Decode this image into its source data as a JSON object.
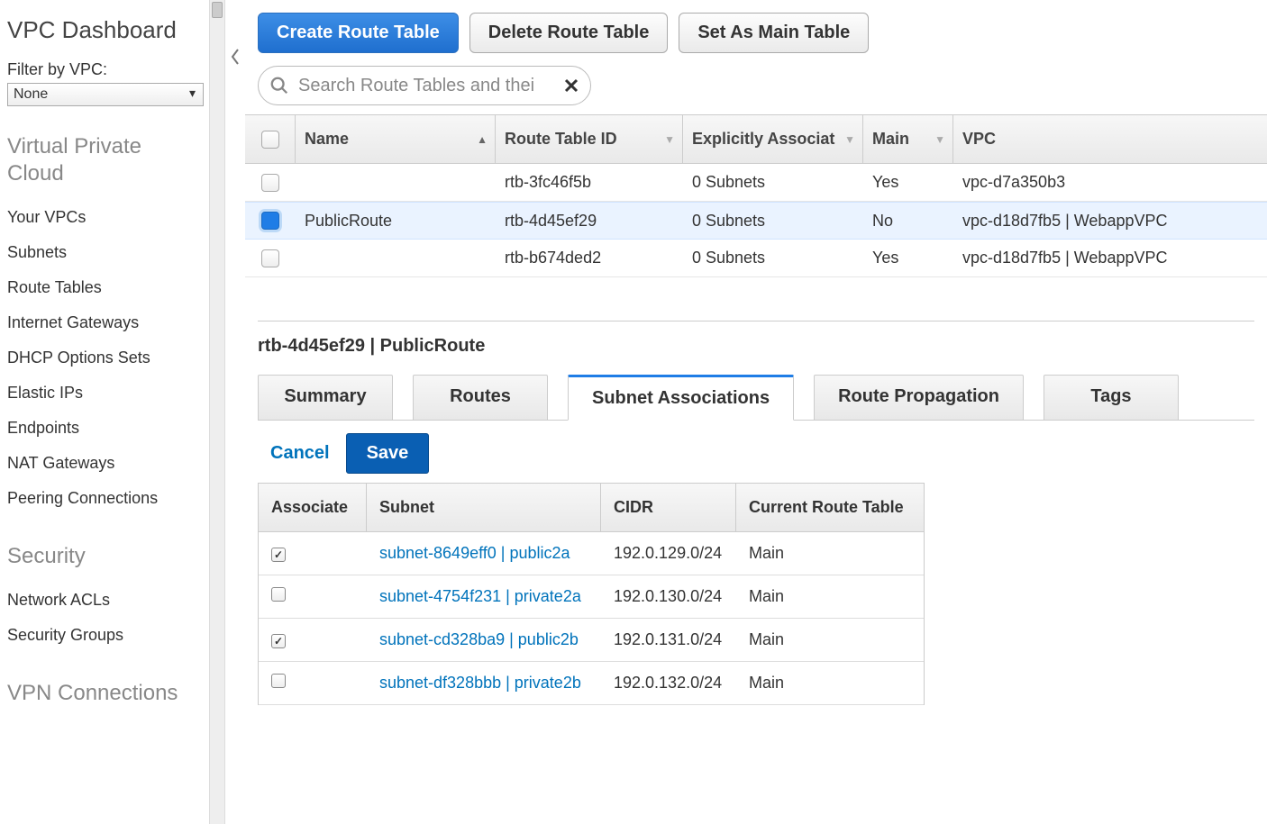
{
  "sidebar": {
    "title": "VPC Dashboard",
    "filter_label": "Filter by VPC:",
    "filter_value": "None",
    "sections": [
      {
        "heading": "Virtual Private Cloud",
        "items": [
          "Your VPCs",
          "Subnets",
          "Route Tables",
          "Internet Gateways",
          "DHCP Options Sets",
          "Elastic IPs",
          "Endpoints",
          "NAT Gateways",
          "Peering Connections"
        ]
      },
      {
        "heading": "Security",
        "items": [
          "Network ACLs",
          "Security Groups"
        ]
      },
      {
        "heading": "VPN Connections",
        "items": []
      }
    ]
  },
  "toolbar": {
    "create": "Create Route Table",
    "delete": "Delete Route Table",
    "setmain": "Set As Main Table"
  },
  "search": {
    "placeholder": "Search Route Tables and thei"
  },
  "table": {
    "headers": {
      "name": "Name",
      "rtid": "Route Table ID",
      "assoc": "Explicitly Associat",
      "main": "Main",
      "vpc": "VPC"
    },
    "rows": [
      {
        "selected": false,
        "name": "",
        "rtid": "rtb-3fc46f5b",
        "assoc": "0 Subnets",
        "main": "Yes",
        "vpc": "vpc-d7a350b3"
      },
      {
        "selected": true,
        "name": "PublicRoute",
        "rtid": "rtb-4d45ef29",
        "assoc": "0 Subnets",
        "main": "No",
        "vpc": "vpc-d18d7fb5 | WebappVPC"
      },
      {
        "selected": false,
        "name": "",
        "rtid": "rtb-b674ded2",
        "assoc": "0 Subnets",
        "main": "Yes",
        "vpc": "vpc-d18d7fb5 | WebappVPC"
      }
    ]
  },
  "details": {
    "title": "rtb-4d45ef29 | PublicRoute",
    "tabs": [
      "Summary",
      "Routes",
      "Subnet Associations",
      "Route Propagation",
      "Tags"
    ],
    "active_tab": 2,
    "actions": {
      "cancel": "Cancel",
      "save": "Save"
    },
    "assoc": {
      "headers": {
        "associate": "Associate",
        "subnet": "Subnet",
        "cidr": "CIDR",
        "crt": "Current Route Table"
      },
      "rows": [
        {
          "checked": true,
          "subnet": "subnet-8649eff0 | public2a",
          "cidr": "192.0.129.0/24",
          "crt": "Main"
        },
        {
          "checked": false,
          "subnet": "subnet-4754f231 | private2a",
          "cidr": "192.0.130.0/24",
          "crt": "Main"
        },
        {
          "checked": true,
          "subnet": "subnet-cd328ba9 | public2b",
          "cidr": "192.0.131.0/24",
          "crt": "Main"
        },
        {
          "checked": false,
          "subnet": "subnet-df328bbb | private2b",
          "cidr": "192.0.132.0/24",
          "crt": "Main"
        }
      ]
    }
  }
}
